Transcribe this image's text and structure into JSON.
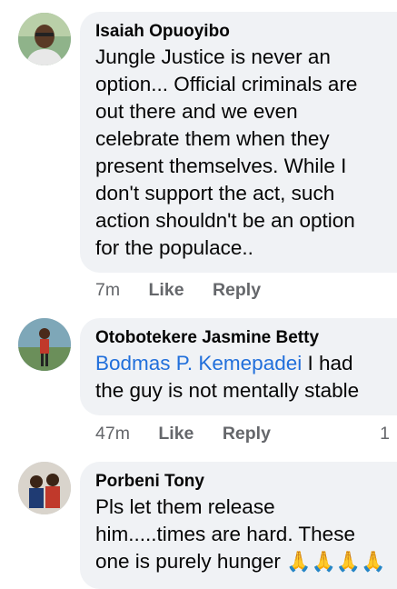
{
  "comments": [
    {
      "author": "Isaiah Opuoyibo",
      "text": "Jungle Justice is never an option... Official criminals are out there and we even celebrate them when they present themselves. While I don't support the act, such action  shouldn't be an option for the populace..",
      "lines": [
        "Jungle Justice is never an",
        "option... Official criminals are",
        "out there and we even",
        "celebrate them when they",
        "present themselves. While I",
        "don't support the act, such",
        "action  shouldn't be an option",
        "for the populace.."
      ],
      "time": "7m",
      "like_label": "Like",
      "reply_label": "Reply"
    },
    {
      "author": "Otobotekere Jasmine Betty",
      "mention": "Bodmas P. Kemepadei",
      "text_after_mention": " I had",
      "line2": "the guy is not mentally stable",
      "time": "47m",
      "like_label": "Like",
      "reply_label": "Reply",
      "reaction_count": "1"
    },
    {
      "author": "Porbeni Tony",
      "lines": [
        "Pls let them release",
        "him.....times are hard. These",
        "one is purely hunger "
      ],
      "emoji": "🙏🙏🙏🙏"
    }
  ],
  "colors": {
    "bubble": "#f0f2f5",
    "name": "#050505",
    "mention": "#216fdb",
    "meta": "#65676b"
  }
}
